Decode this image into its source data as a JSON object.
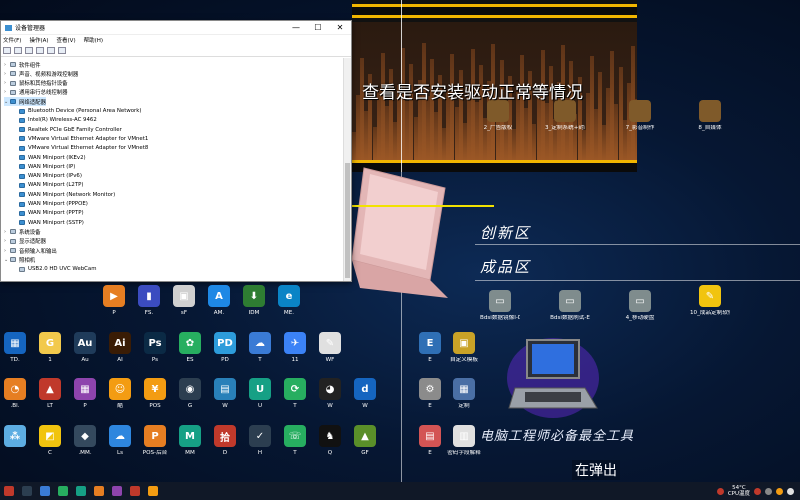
{
  "device_manager": {
    "title": "设备管理器",
    "menu": [
      "文件(F)",
      "操作(A)",
      "查看(V)",
      "帮助(H)"
    ],
    "window_controls": [
      "—",
      "☐",
      "✕"
    ],
    "tree": [
      {
        "label": "软件组件",
        "level": 0,
        "expand": "›"
      },
      {
        "label": "声音、视频和游戏控制器",
        "level": 0,
        "expand": "›"
      },
      {
        "label": "鼠标和其他指针设备",
        "level": 0,
        "expand": "›"
      },
      {
        "label": "通用串行总线控制器",
        "level": 0,
        "expand": "›"
      },
      {
        "label": "网络适配器",
        "level": 0,
        "expand": "⌄",
        "selected": true,
        "net": true
      },
      {
        "label": "Bluetooth Device (Personal Area Network)",
        "level": 1,
        "net": true
      },
      {
        "label": "Intel(R) Wireless-AC 9462",
        "level": 1,
        "net": true
      },
      {
        "label": "Realtek PCIe GbE Family Controller",
        "level": 1,
        "net": true
      },
      {
        "label": "VMware Virtual Ethernet Adapter for VMnet1",
        "level": 1,
        "net": true
      },
      {
        "label": "VMware Virtual Ethernet Adapter for VMnet8",
        "level": 1,
        "net": true
      },
      {
        "label": "WAN Miniport (IKEv2)",
        "level": 1,
        "net": true
      },
      {
        "label": "WAN Miniport (IP)",
        "level": 1,
        "net": true
      },
      {
        "label": "WAN Miniport (IPv6)",
        "level": 1,
        "net": true
      },
      {
        "label": "WAN Miniport (L2TP)",
        "level": 1,
        "net": true
      },
      {
        "label": "WAN Miniport (Network Monitor)",
        "level": 1,
        "net": true
      },
      {
        "label": "WAN Miniport (PPPOE)",
        "level": 1,
        "net": true
      },
      {
        "label": "WAN Miniport (PPTP)",
        "level": 1,
        "net": true
      },
      {
        "label": "WAN Miniport (SSTP)",
        "level": 1,
        "net": true
      },
      {
        "label": "系统设备",
        "level": 0,
        "expand": "›"
      },
      {
        "label": "显示适配器",
        "level": 0,
        "expand": "›"
      },
      {
        "label": "音频输入和输出",
        "level": 0,
        "expand": "›"
      },
      {
        "label": "照相机",
        "level": 0,
        "expand": "⌄"
      },
      {
        "label": "USB2.0 HD UVC WebCam",
        "level": 1
      }
    ]
  },
  "banner": {
    "caption": "查看是否安装驱动正常等情况",
    "icons": [
      {
        "label": "2_广告版权"
      },
      {
        "label": "3_定制系统+封装技术"
      },
      {
        "label": "7_影音制作"
      },
      {
        "label": "8_自媒体"
      }
    ]
  },
  "sections": {
    "innovation": "创新区",
    "finished": "成品区",
    "tools": "电脑工程师必备最全工具",
    "popup": "在弹出"
  },
  "finished_icons": [
    {
      "label": "Bdsi数据镜像I-D",
      "color": "#7f8c8d",
      "glyph": "▭"
    },
    {
      "label": "Bdsi数据刷试-E",
      "color": "#7f8c8d",
      "glyph": "▭"
    },
    {
      "label": "4_移动硬盘",
      "color": "#7f8c8d",
      "glyph": "▭"
    },
    {
      "label": "10_成品定制软件",
      "color": "#f1c40f",
      "glyph": "✎"
    }
  ],
  "right_icons": [
    {
      "label": "E",
      "color": "#2f6fb5",
      "glyph": "E"
    },
    {
      "label": "自定义模板",
      "color": "#c9a227",
      "glyph": "▣"
    },
    {
      "label": "E",
      "color": "#8b8b8b",
      "glyph": "⚙"
    },
    {
      "label": "定制",
      "color": "#4a6fa5",
      "glyph": "▦"
    },
    {
      "label": "E",
      "color": "#d35454",
      "glyph": "▤"
    },
    {
      "label": "密码字段解释",
      "color": "#e0e0e0",
      "glyph": "▥"
    }
  ],
  "desktop_rows": [
    [
      {
        "label": "P",
        "color": "#e67e22",
        "glyph": "▶"
      },
      {
        "label": "FS.",
        "color": "#3b4cc0",
        "glyph": "▮"
      },
      {
        "label": "sF",
        "color": "#d0d0d0",
        "glyph": "▣"
      },
      {
        "label": "AM.",
        "color": "#1e88e5",
        "glyph": "A"
      },
      {
        "label": "IDM",
        "color": "#2e7d32",
        "glyph": "⬇"
      },
      {
        "label": "ME.",
        "color": "#0a84c6",
        "glyph": "e"
      }
    ],
    [
      {
        "label": "TD.",
        "color": "#1565c0",
        "glyph": "▦"
      },
      {
        "label": "1",
        "color": "#f2c94c",
        "glyph": "G"
      },
      {
        "label": "Au",
        "color": "#1f3b5a",
        "glyph": "Au"
      },
      {
        "label": "AI",
        "color": "#3a1c05",
        "glyph": "Ai"
      },
      {
        "label": "Ps",
        "color": "#0b2a45",
        "glyph": "Ps"
      },
      {
        "label": "ES",
        "color": "#27ae60",
        "glyph": "✿"
      },
      {
        "label": "PD",
        "color": "#2d9cdb",
        "glyph": "PD"
      },
      {
        "label": "T",
        "color": "#3a7bd5",
        "glyph": "☁"
      },
      {
        "label": "11",
        "color": "#3b82f6",
        "glyph": "✈"
      },
      {
        "label": "WF",
        "color": "#e0e0e0",
        "glyph": "✎"
      }
    ],
    [
      {
        "label": ".Bl.",
        "color": "#e67e22",
        "glyph": "◔"
      },
      {
        "label": "LT",
        "color": "#c0392b",
        "glyph": "▲"
      },
      {
        "label": "P",
        "color": "#8e44ad",
        "glyph": "▦"
      },
      {
        "label": "酷",
        "color": "#f39c12",
        "glyph": "☺"
      },
      {
        "label": "POS",
        "color": "#f39c12",
        "glyph": "¥"
      },
      {
        "label": "G",
        "color": "#2c3e50",
        "glyph": "◉"
      },
      {
        "label": "W",
        "color": "#2980b9",
        "glyph": "▤"
      },
      {
        "label": "U",
        "color": "#16a085",
        "glyph": "U"
      },
      {
        "label": "T",
        "color": "#27ae60",
        "glyph": "⟳"
      },
      {
        "label": "W",
        "color": "#222222",
        "glyph": "◕"
      },
      {
        "label": "W",
        "color": "#1565c0",
        "glyph": "d"
      }
    ],
    [
      {
        "label": "",
        "color": "#5dade2",
        "glyph": "⁂"
      },
      {
        "label": "C",
        "color": "#f1c40f",
        "glyph": "◩"
      },
      {
        "label": ".MM.",
        "color": "#34495e",
        "glyph": "◆"
      },
      {
        "label": "Ls",
        "color": "#2e86de",
        "glyph": "☁"
      },
      {
        "label": "POS-后台",
        "color": "#e67e22",
        "glyph": "P"
      },
      {
        "label": "MM",
        "color": "#16a085",
        "glyph": "M"
      },
      {
        "label": "D",
        "color": "#c0392b",
        "glyph": "拾"
      },
      {
        "label": "H",
        "color": "#2c3e50",
        "glyph": "✓"
      },
      {
        "label": "T",
        "color": "#27ae60",
        "glyph": "☏"
      },
      {
        "label": "Q",
        "color": "#111111",
        "glyph": "♞"
      },
      {
        "label": "GF",
        "color": "#5a8f29",
        "glyph": "▲"
      }
    ]
  ],
  "taskbar": {
    "icons": [
      "#c0392b",
      "#2c3e50",
      "#3a7bd5",
      "#27ae60",
      "#16a085",
      "#e67e22",
      "#8e44ad",
      "#c0392b",
      "#f39c12"
    ],
    "temp": "54°C",
    "cpu": "CPU温度"
  }
}
